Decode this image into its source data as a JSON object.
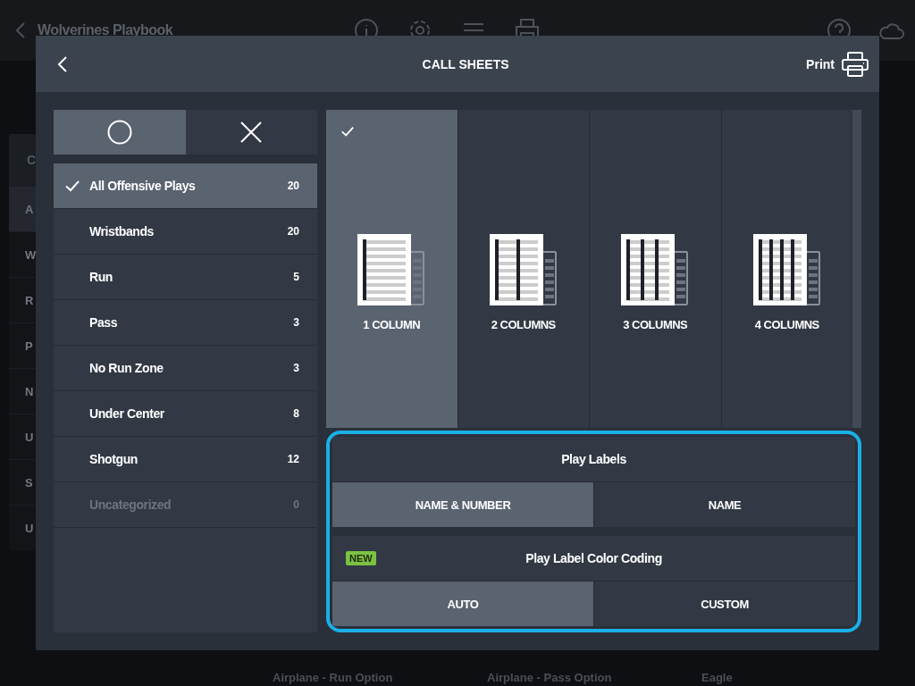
{
  "app": {
    "title": "Wolverines Playbook",
    "sidebar_heading": "C",
    "sidebar_items": [
      {
        "label": "A",
        "selected": true
      },
      {
        "label": "W",
        "selected": false
      },
      {
        "label": "R",
        "selected": false
      },
      {
        "label": "P",
        "selected": false
      },
      {
        "label": "N",
        "selected": false
      },
      {
        "label": "U",
        "selected": false
      },
      {
        "label": "S",
        "selected": false
      },
      {
        "label": "U",
        "selected": false
      }
    ],
    "cards": [
      {
        "title": "Airplane - Run Option"
      },
      {
        "title": "Airplane - Pass Option"
      },
      {
        "title": "Eagle"
      }
    ]
  },
  "dialog": {
    "title": "CALL SHEETS",
    "print_label": "Print",
    "filter_tabs": [
      {
        "kind": "circle",
        "selected": true
      },
      {
        "kind": "cross",
        "selected": false
      }
    ],
    "categories": [
      {
        "name": "All Offensive Plays",
        "count": "20",
        "selected": true,
        "disabled": false
      },
      {
        "name": "Wristbands",
        "count": "20",
        "selected": false,
        "disabled": false
      },
      {
        "name": "Run",
        "count": "5",
        "selected": false,
        "disabled": false
      },
      {
        "name": "Pass",
        "count": "3",
        "selected": false,
        "disabled": false
      },
      {
        "name": "No Run Zone",
        "count": "3",
        "selected": false,
        "disabled": false
      },
      {
        "name": "Under Center",
        "count": "8",
        "selected": false,
        "disabled": false
      },
      {
        "name": "Shotgun",
        "count": "12",
        "selected": false,
        "disabled": false
      },
      {
        "name": "Uncategorized",
        "count": "0",
        "selected": false,
        "disabled": true
      }
    ],
    "layouts": [
      {
        "label": "1 COLUMN",
        "selected": true
      },
      {
        "label": "2 COLUMNS",
        "selected": false
      },
      {
        "label": "3 COLUMNS",
        "selected": false
      },
      {
        "label": "4 COLUMNS",
        "selected": false
      }
    ],
    "label_settings": {
      "highlighted": true,
      "play_labels": {
        "title": "Play Labels",
        "options": [
          {
            "label": "NAME & NUMBER",
            "selected": true
          },
          {
            "label": "NAME",
            "selected": false
          }
        ]
      },
      "color_coding": {
        "badge": "NEW",
        "title": "Play Label Color Coding",
        "options": [
          {
            "label": "AUTO",
            "selected": true
          },
          {
            "label": "CUSTOM",
            "selected": false
          }
        ]
      }
    }
  }
}
